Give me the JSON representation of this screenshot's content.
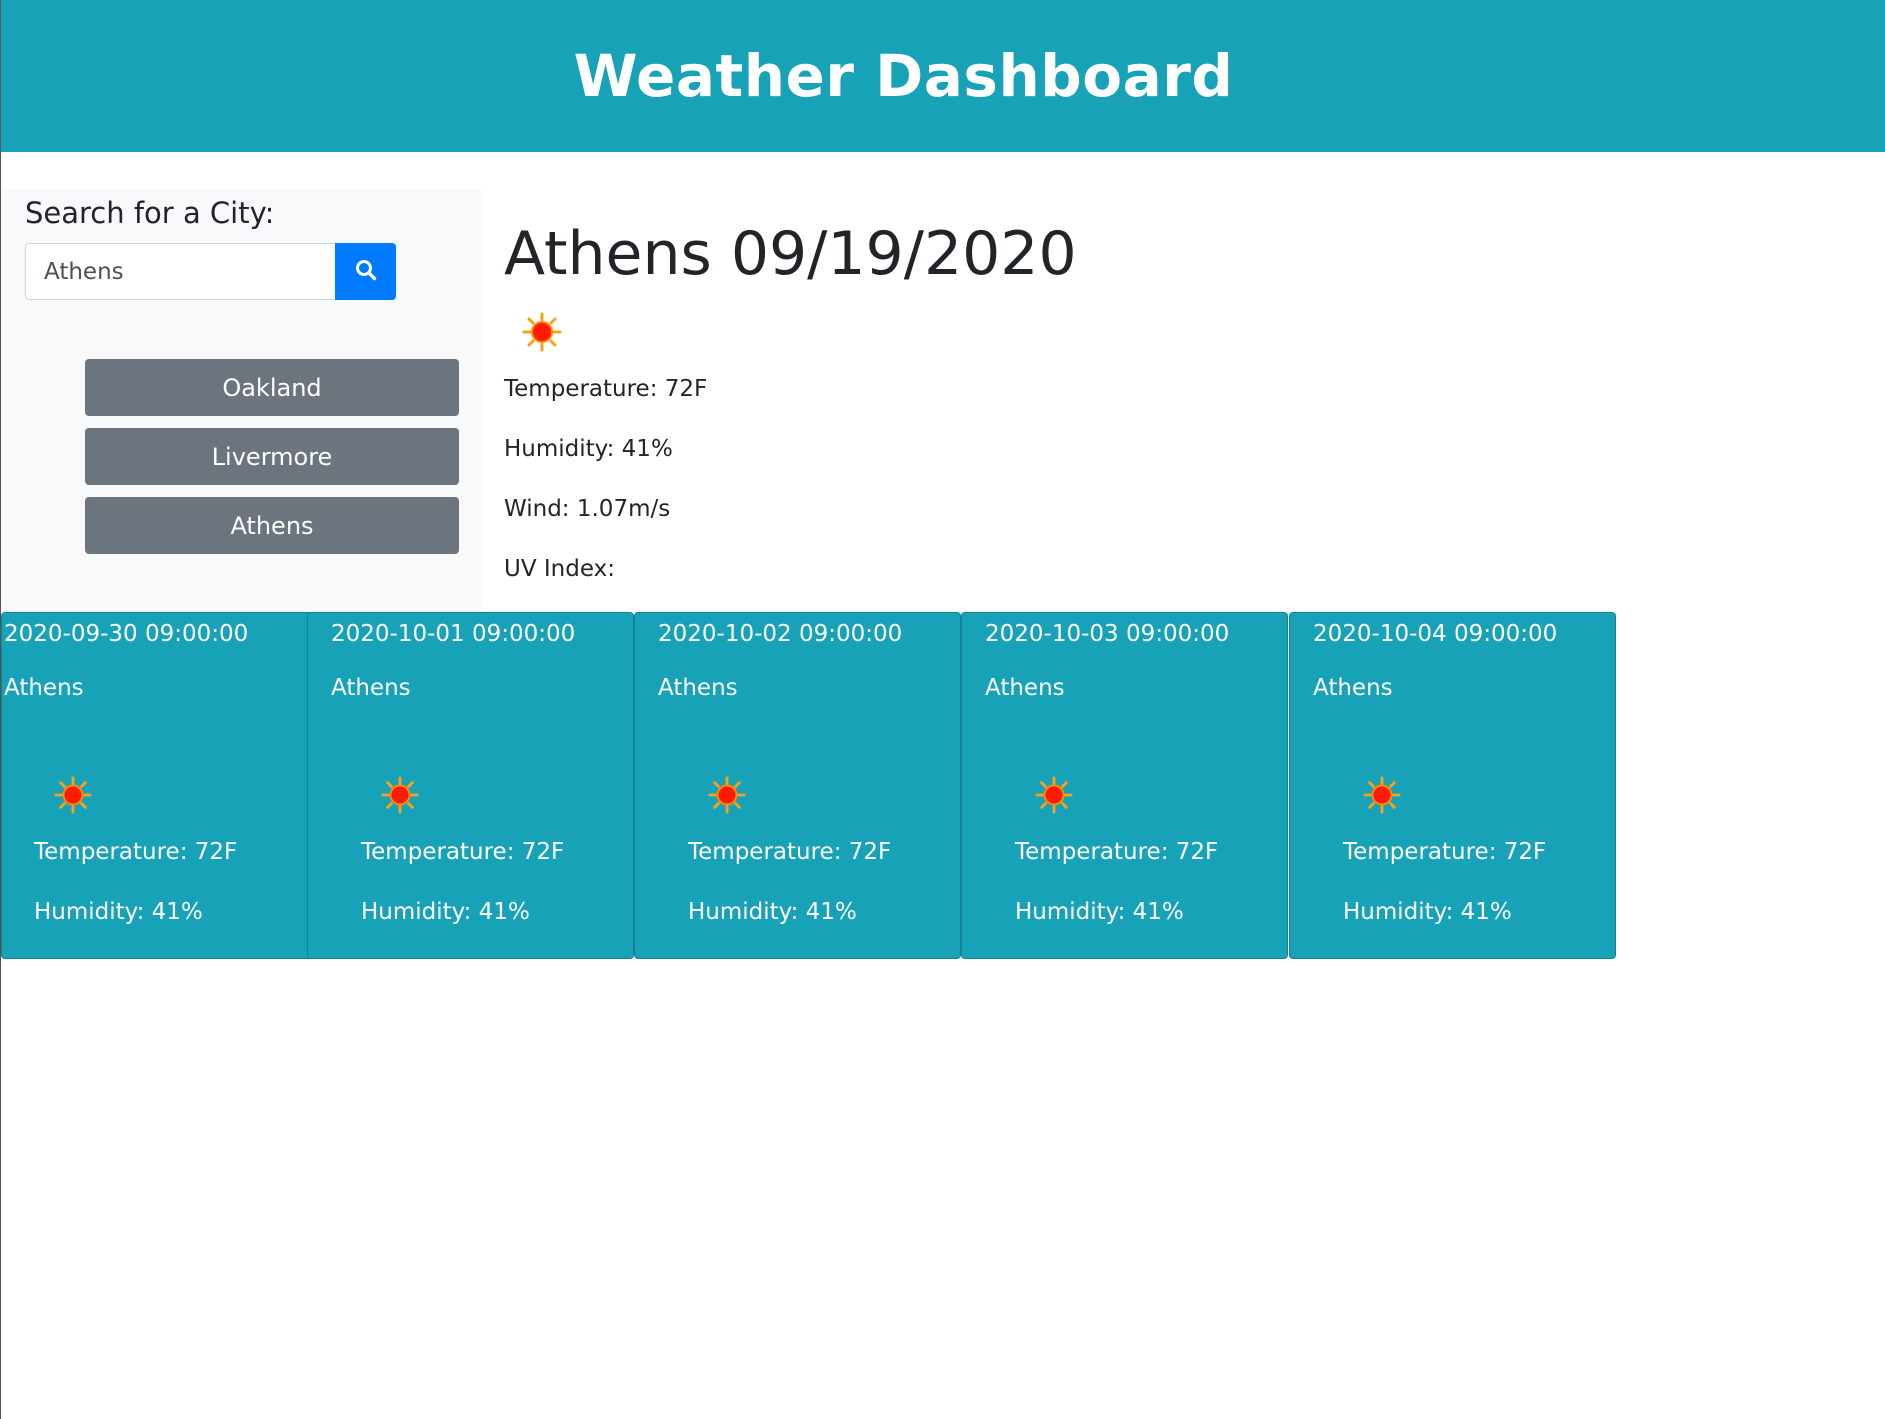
{
  "header": {
    "title": "Weather Dashboard"
  },
  "search": {
    "label": "Search for a City:",
    "value": "Athens",
    "button_icon": "search-icon"
  },
  "history": [
    {
      "label": "Oakland"
    },
    {
      "label": "Livermore"
    },
    {
      "label": "Athens"
    }
  ],
  "current": {
    "title": "Athens 09/19/2020",
    "icon": "sun-icon",
    "temperature": "Temperature: 72F",
    "humidity": "Humidity: 41%",
    "wind": "Wind: 1.07m/s",
    "uv": "UV Index:"
  },
  "forecast": [
    {
      "date": "2020-09-30 09:00:00",
      "city": "Athens",
      "icon": "sun-icon",
      "temperature": "Temperature: 72F",
      "humidity": "Humidity: 41%"
    },
    {
      "date": "2020-10-01 09:00:00",
      "city": "Athens",
      "icon": "sun-icon",
      "temperature": "Temperature: 72F",
      "humidity": "Humidity: 41%"
    },
    {
      "date": "2020-10-02 09:00:00",
      "city": "Athens",
      "icon": "sun-icon",
      "temperature": "Temperature: 72F",
      "humidity": "Humidity: 41%"
    },
    {
      "date": "2020-10-03 09:00:00",
      "city": "Athens",
      "icon": "sun-icon",
      "temperature": "Temperature: 72F",
      "humidity": "Humidity: 41%"
    },
    {
      "date": "2020-10-04 09:00:00",
      "city": "Athens",
      "icon": "sun-icon",
      "temperature": "Temperature: 72F",
      "humidity": "Humidity: 41%"
    }
  ],
  "colors": {
    "header_bg": "#17a2b8",
    "card_bg": "#17a2b8",
    "search_button": "#007bff",
    "history_button": "#6c757d",
    "sidebar_bg": "#f8f9fa"
  }
}
